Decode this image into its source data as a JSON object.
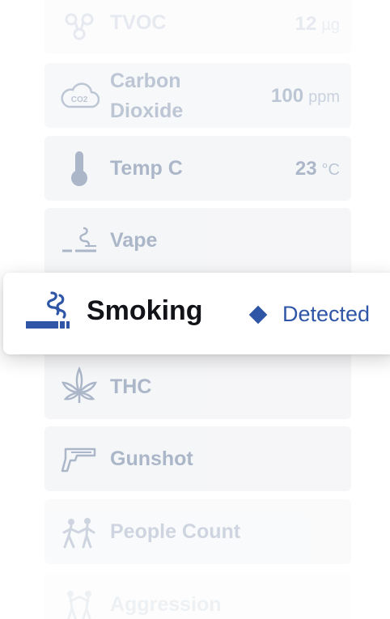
{
  "sensors": [
    {
      "label": "TVOC",
      "value": "12",
      "unit": "µg",
      "icon": "tvoc-molecule-icon"
    },
    {
      "label": "Carbon Dioxide",
      "label_line1": "Carbon",
      "label_line2": "Dioxide",
      "value": "100",
      "unit": "ppm",
      "icon": "co2-cloud-icon"
    },
    {
      "label": "Temp C",
      "value": "23",
      "unit": "°C",
      "icon": "thermometer-icon"
    },
    {
      "label": "Vape",
      "icon": "vape-icon"
    },
    {
      "label": "THC",
      "icon": "cannabis-leaf-icon"
    },
    {
      "label": "Gunshot",
      "icon": "gun-icon"
    },
    {
      "label": "People Count",
      "icon": "people-icon"
    },
    {
      "label": "Aggression",
      "icon": "aggression-icon"
    }
  ],
  "featured": {
    "label": "Smoking",
    "status": "Detected",
    "icon": "cigarette-icon",
    "accent": "#2f56a6"
  },
  "colors": {
    "muted": "#a7b4c7",
    "card_bg": "#f5f6f8",
    "accent": "#2f56a6",
    "featured_title": "#111318"
  }
}
